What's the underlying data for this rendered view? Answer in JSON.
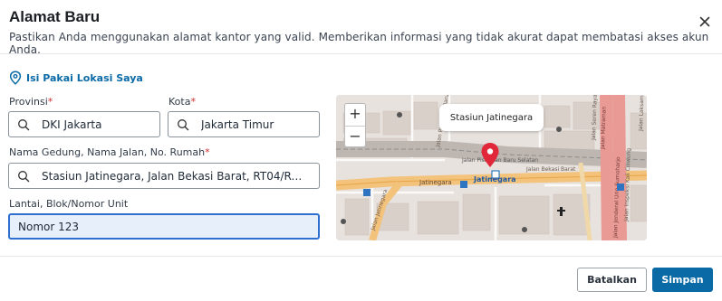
{
  "dialog": {
    "title": "Alamat Baru",
    "subtitle": "Pastikan Anda menggunakan alamat kantor yang valid. Memberikan informasi yang tidak akurat dapat membatasi akses akun Anda."
  },
  "use_location_label": "Isi Pakai Lokasi Saya",
  "form": {
    "provinsi": {
      "label": "Provinsi",
      "required_mark": "*",
      "value": "DKI Jakarta"
    },
    "kota": {
      "label": "Kota",
      "required_mark": "*",
      "value": "Jakarta Timur"
    },
    "alamat": {
      "label": "Nama Gedung, Nama Jalan, No. Rumah",
      "required_mark": "*",
      "value": "Stasiun Jatinegara, Jalan Bekasi Barat, RT04/RW02, ..."
    },
    "lantai": {
      "label": "Lantai, Blok/Nomor Unit",
      "value": "Nomor 123"
    }
  },
  "map": {
    "popup_label": "Stasiun Jatinegara",
    "zoom_in": "+",
    "zoom_out": "−",
    "place_labels": [
      "Jatinegara",
      "Jatinegara",
      "Jalan Jatinegara",
      "Jalan Pisangan Baru Selatan",
      "Jalan Pisangan Baru III",
      "Jalan Bekasi Barat",
      "Jalan Matraman",
      "Jalan Jenderal Urip Sumoharjo",
      "Jalan Inspeksi Kali Ciliwung",
      "Jalan Seren Raya",
      "Jalan Laksamana"
    ]
  },
  "buttons": {
    "cancel": "Batalkan",
    "save": "Simpan"
  },
  "colors": {
    "primary": "#0a6aa6",
    "required": "#d12c2c",
    "focus_border": "#2f6fd0",
    "pin": "#e0283a"
  }
}
